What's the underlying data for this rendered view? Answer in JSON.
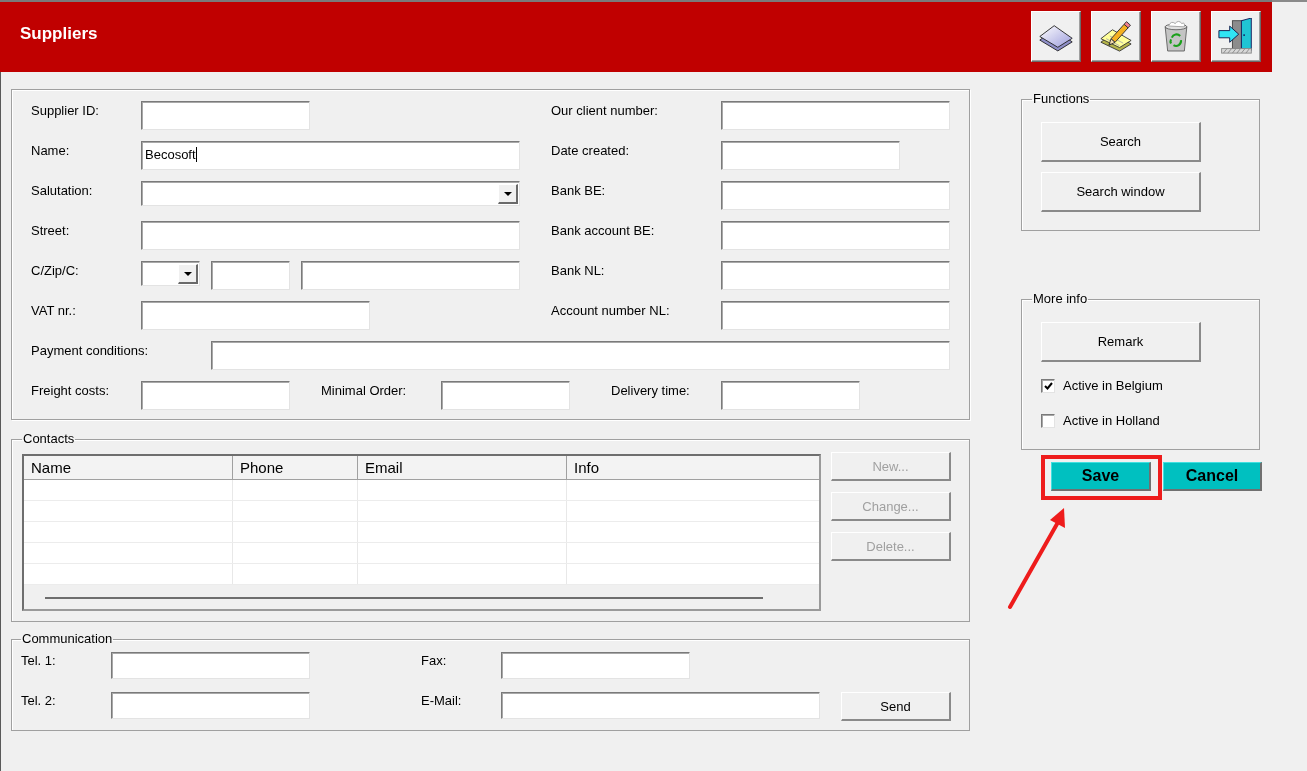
{
  "window": {
    "title": "Suppliers"
  },
  "details": {
    "rows": [
      {
        "fields": [
          {
            "label": "Supplier ID:",
            "kind": "text",
            "focused": false
          },
          {
            "label": "Our client number:",
            "kind": "text",
            "focused": false
          }
        ]
      },
      {
        "fields": [
          {
            "label": "Name:",
            "kind": "text",
            "value": "Becosoft",
            "focused": true
          },
          {
            "label": "Date created:",
            "kind": "text",
            "focused": false
          }
        ]
      },
      {
        "fields": [
          {
            "label": "Salutation:",
            "kind": "dropdown",
            "focused": false
          },
          {
            "label": "Bank BE:",
            "kind": "text",
            "focused": false
          }
        ]
      },
      {
        "fields": [
          {
            "label": "Street:",
            "kind": "text",
            "focused": false
          },
          {
            "label": "Bank account BE:",
            "kind": "text",
            "focused": false
          }
        ]
      },
      {
        "fields": [
          {
            "label": "C/Zip/C:",
            "kind": "dropdown",
            "focused": false
          },
          {
            "kind": "text",
            "focused": false
          },
          {
            "kind": "text",
            "focused": false
          },
          {
            "label": "Bank NL:",
            "kind": "text",
            "focused": false
          }
        ]
      },
      {
        "fields": [
          {
            "label": "VAT nr.:",
            "kind": "text",
            "focused": false
          },
          {
            "label": "Account number NL:",
            "kind": "text",
            "focused": false
          }
        ]
      },
      {
        "fields": [
          {
            "label": "Payment conditions:",
            "kind": "text",
            "focused": false
          }
        ]
      },
      {
        "fields": [
          {
            "label": "Freight costs:",
            "kind": "text",
            "focused": false
          },
          {
            "label": "Minimal Order:",
            "kind": "text",
            "focused": false
          },
          {
            "label": "Delivery time:",
            "kind": "text",
            "focused": false
          }
        ]
      }
    ]
  },
  "contacts": {
    "title": "Contacts",
    "columns": [
      "Name",
      "Phone",
      "Email",
      "Info"
    ],
    "buttons": [
      {
        "label": "New...",
        "disabled": true
      },
      {
        "label": "Change...",
        "disabled": true
      },
      {
        "label": "Delete...",
        "disabled": true
      }
    ]
  },
  "communication": {
    "title": "Communication",
    "rows": [
      {
        "fields": [
          {
            "label": "Tel. 1:",
            "kind": "text"
          },
          {
            "label": "Fax:",
            "kind": "text"
          }
        ]
      },
      {
        "fields": [
          {
            "label": "Tel. 2:",
            "kind": "text"
          },
          {
            "label": "E-Mail:",
            "kind": "text"
          }
        ],
        "button": {
          "label": "Send"
        }
      }
    ]
  },
  "functions": {
    "title": "Functions",
    "buttons": [
      "Search",
      "Search window"
    ]
  },
  "more_info": {
    "title": "More info",
    "button": "Remark",
    "options": [
      {
        "label": "Active in Belgium",
        "checked": true
      },
      {
        "label": "Active in Holland",
        "checked": false
      }
    ]
  },
  "actions": [
    {
      "label": "Save",
      "highlighted": true
    },
    {
      "label": "Cancel",
      "highlighted": false
    }
  ],
  "annotations": [
    {
      "kind": "arrow"
    }
  ]
}
